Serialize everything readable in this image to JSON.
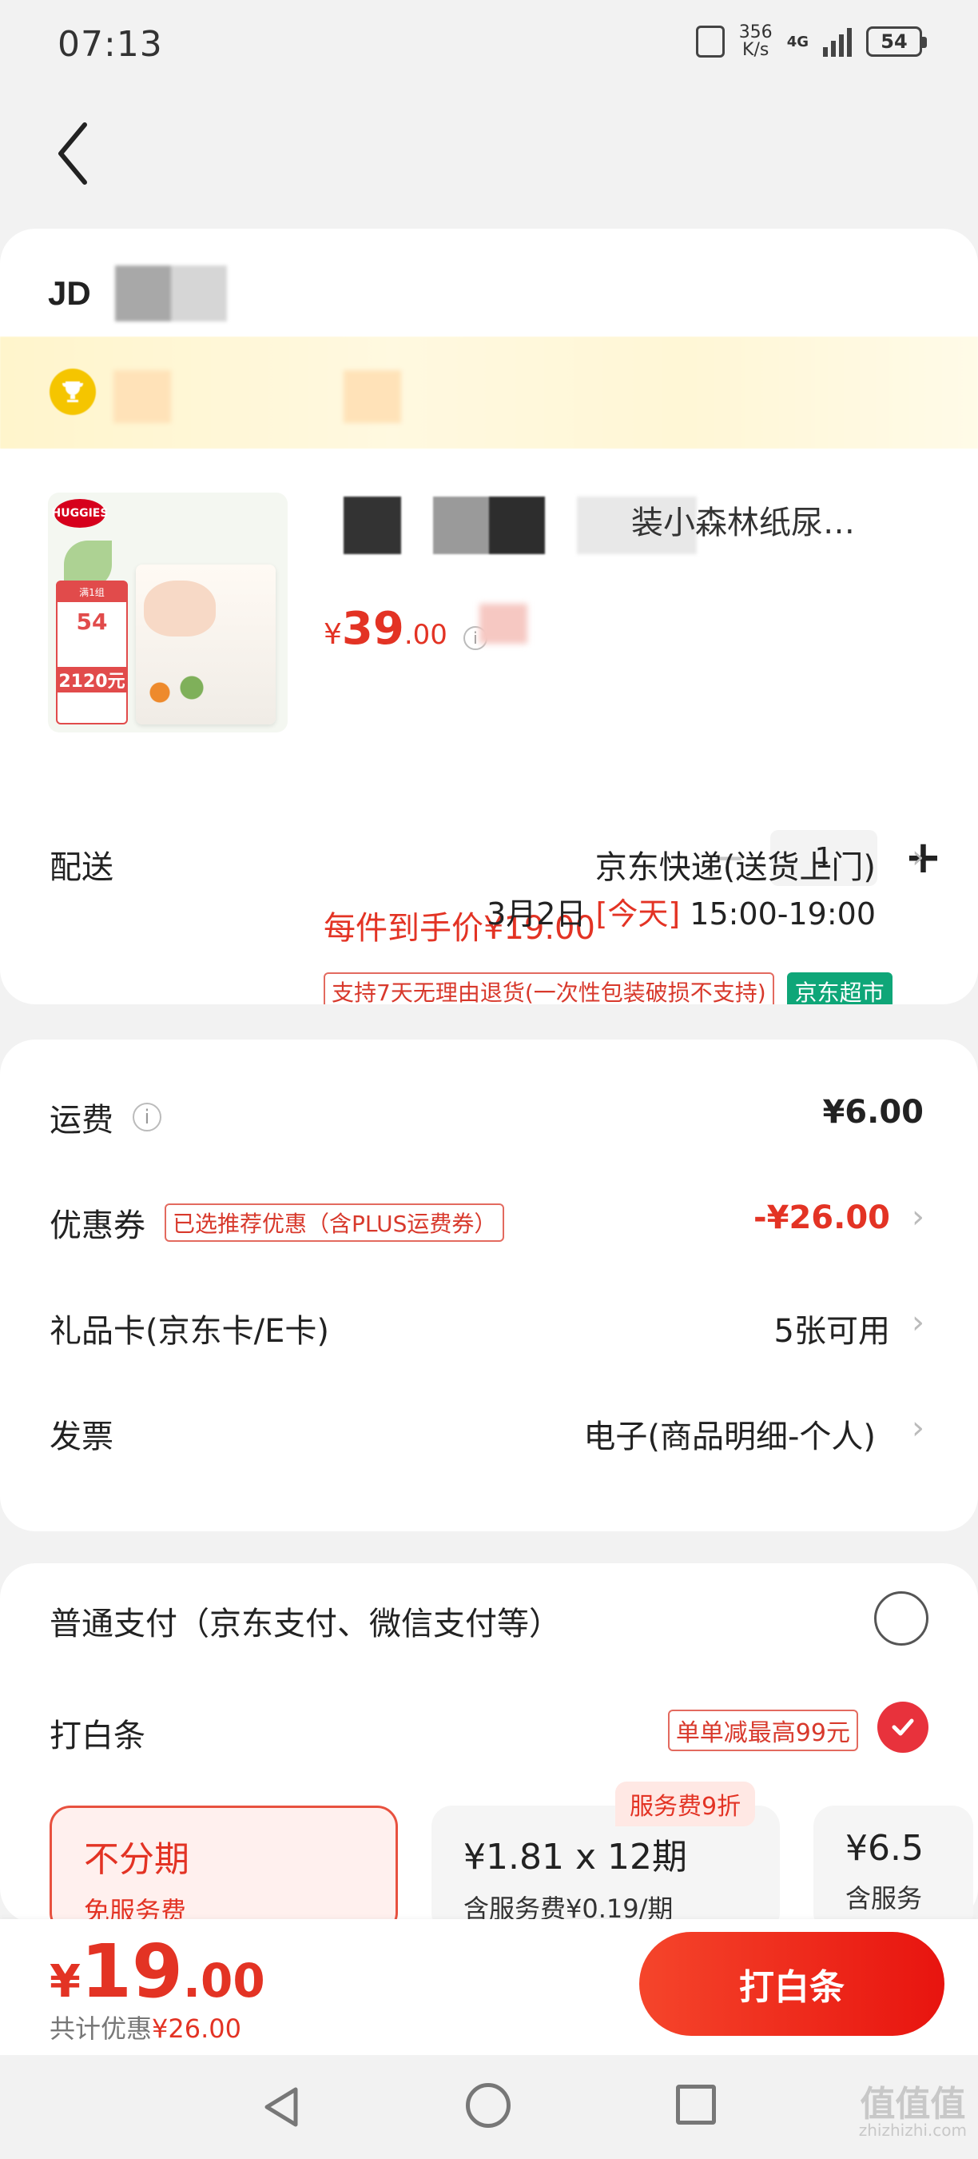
{
  "status_bar": {
    "time": "07:13",
    "net_speed_value": "356",
    "net_speed_unit": "K/s",
    "network_type": "4G",
    "battery": "54"
  },
  "store": {
    "logo_text": "JD"
  },
  "product": {
    "title": "装小森林纸尿…",
    "price_currency": "¥",
    "price_int": "39",
    "price_dec": ".00",
    "final_price_text": "每件到手价¥19.00",
    "quantity": "1",
    "qty_minus": "−",
    "qty_plus": "+",
    "image_texts": {
      "brand": "HUGGIES",
      "promo_top": "满1组",
      "promo_num": "54",
      "promo_bottom": "2120元"
    },
    "tags": {
      "return_policy": "支持7天无理由退货(一次性包装破损不支持)",
      "market": "京东超市"
    }
  },
  "delivery": {
    "label": "配送",
    "method": "京东快递(送货上门)",
    "date": "3月2日",
    "today": "[今天]",
    "time_range": "15:00-19:00"
  },
  "costs": {
    "shipping_label": "运费",
    "shipping_value": "¥6.00",
    "coupon_label": "优惠券",
    "coupon_tag": "已选推荐优惠（含PLUS运费券）",
    "coupon_value": "-¥26.00",
    "giftcard_label": "礼品卡(京东卡/E卡)",
    "giftcard_value": "5张可用",
    "invoice_label": "发票",
    "invoice_value": "电子(商品明细-个人)"
  },
  "payment": {
    "normal_label": "普通支付（京东支付、微信支付等）",
    "baitiao_label": "打白条",
    "baitiao_tag": "单单减最高99元",
    "fee_badge": "服务费9折",
    "plans": [
      {
        "title": "不分期",
        "sub": "免服务费"
      },
      {
        "title": "¥1.81 x 12期",
        "sub": "含服务费¥0.19/期"
      },
      {
        "title": "¥6.5",
        "sub": "含服务"
      }
    ]
  },
  "bottom": {
    "currency": "¥",
    "total_int": "19",
    "total_dec": ".00",
    "savings_label": "共计优惠",
    "savings_amount": "¥26.00",
    "pay_button": "打白条"
  },
  "watermark": {
    "big": "值值值",
    "small": "zhizhizhi.com"
  }
}
